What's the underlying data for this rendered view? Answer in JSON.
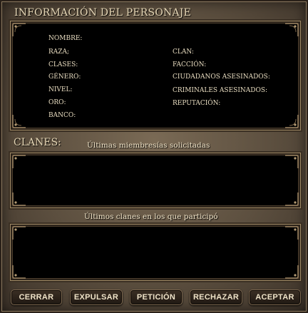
{
  "window": {
    "title": "INFORMACIÓN DEL PERSONAJE"
  },
  "character": {
    "left_labels": [
      "NOMBRE:",
      "RAZA;",
      "CLASES:",
      "GÉNERO:",
      "NIVEL:",
      "ORO:",
      "BANCO:"
    ],
    "right_labels": [
      "CLAN:",
      "FACCIÓN:",
      "CIUDADANOS ASESINADOS:",
      "CRIMINALES ASESINADOS:",
      "REPUTACIÓN:"
    ]
  },
  "clans": {
    "heading": "CLANES:",
    "requested_label": "Últimas miembresías solicitadas",
    "history_label": "Últimos clanes en los que participó"
  },
  "buttons": {
    "close": "CERRAR",
    "expel": "EXPULSAR",
    "request": "PETICIÓN",
    "reject": "RECHAZAR",
    "accept": "ACEPTAR"
  }
}
